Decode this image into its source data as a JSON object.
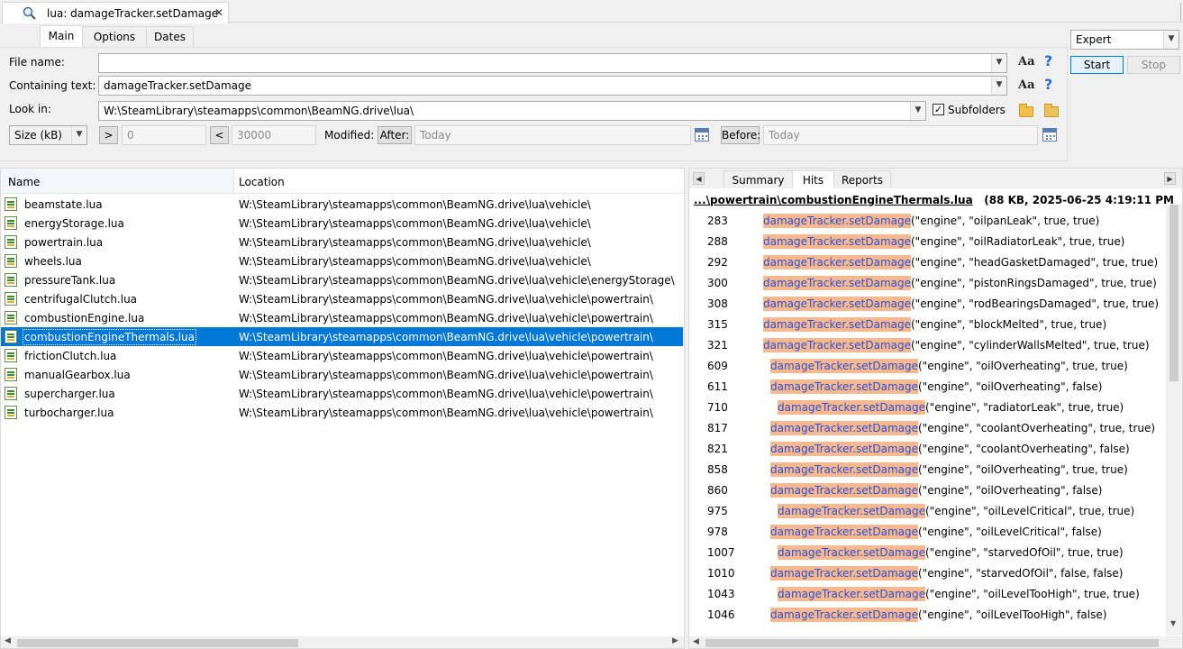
{
  "tab": {
    "title": "lua: damageTracker.setDamage"
  },
  "search": {
    "tabs": [
      "Main",
      "Options",
      "Dates"
    ],
    "file_name_label": "File name:",
    "file_name_value": "",
    "containing_text_label": "Containing text:",
    "containing_text_value": "damageTracker.setDamage",
    "look_in_label": "Look in:",
    "look_in_value": "W:\\SteamLibrary\\steamapps\\common\\BeamNG.drive\\lua\\",
    "subfolders_label": "Subfolders",
    "subfolders_checked": true,
    "size_unit": "Size (kB)",
    "gt_label": ">",
    "gt_value": "0",
    "lt_label": "<",
    "lt_value": "30000",
    "modified_label": "Modified:",
    "after_label": "After:",
    "after_value": "Today",
    "before_label": "Before:",
    "before_value": "Today",
    "mode": "Expert",
    "start_label": "Start",
    "stop_label": "Stop",
    "aa_label": "Aa",
    "help_label": "?"
  },
  "results": {
    "columns": [
      "Name",
      "Location"
    ],
    "rows": [
      {
        "name": "beamstate.lua",
        "location": "W:\\SteamLibrary\\steamapps\\common\\BeamNG.drive\\lua\\vehicle\\"
      },
      {
        "name": "energyStorage.lua",
        "location": "W:\\SteamLibrary\\steamapps\\common\\BeamNG.drive\\lua\\vehicle\\"
      },
      {
        "name": "powertrain.lua",
        "location": "W:\\SteamLibrary\\steamapps\\common\\BeamNG.drive\\lua\\vehicle\\"
      },
      {
        "name": "wheels.lua",
        "location": "W:\\SteamLibrary\\steamapps\\common\\BeamNG.drive\\lua\\vehicle\\"
      },
      {
        "name": "pressureTank.lua",
        "location": "W:\\SteamLibrary\\steamapps\\common\\BeamNG.drive\\lua\\vehicle\\energyStorage\\"
      },
      {
        "name": "centrifugalClutch.lua",
        "location": "W:\\SteamLibrary\\steamapps\\common\\BeamNG.drive\\lua\\vehicle\\powertrain\\"
      },
      {
        "name": "combustionEngine.lua",
        "location": "W:\\SteamLibrary\\steamapps\\common\\BeamNG.drive\\lua\\vehicle\\powertrain\\"
      },
      {
        "name": "combustionEngineThermals.lua",
        "location": "W:\\SteamLibrary\\steamapps\\common\\BeamNG.drive\\lua\\vehicle\\powertrain\\",
        "selected": true
      },
      {
        "name": "frictionClutch.lua",
        "location": "W:\\SteamLibrary\\steamapps\\common\\BeamNG.drive\\lua\\vehicle\\powertrain\\"
      },
      {
        "name": "manualGearbox.lua",
        "location": "W:\\SteamLibrary\\steamapps\\common\\BeamNG.drive\\lua\\vehicle\\powertrain\\"
      },
      {
        "name": "supercharger.lua",
        "location": "W:\\SteamLibrary\\steamapps\\common\\BeamNG.drive\\lua\\vehicle\\powertrain\\"
      },
      {
        "name": "turbocharger.lua",
        "location": "W:\\SteamLibrary\\steamapps\\common\\BeamNG.drive\\lua\\vehicle\\powertrain\\"
      }
    ]
  },
  "preview": {
    "tabs": [
      "Summary",
      "Hits",
      "Reports"
    ],
    "active_tab": "Hits",
    "file_path": "...\\powertrain\\combustionEngineThermals.lua",
    "file_info": "(88 KB,  2025-06-25 4:19:11 PM",
    "match_text": "damageTracker.setDamage",
    "hits": [
      {
        "line": "283",
        "indent": 0,
        "rest": "(\"engine\", \"oilpanLeak\", true, true)"
      },
      {
        "line": "288",
        "indent": 0,
        "rest": "(\"engine\", \"oilRadiatorLeak\", true, true)"
      },
      {
        "line": "292",
        "indent": 0,
        "rest": "(\"engine\", \"headGasketDamaged\", true, true)"
      },
      {
        "line": "300",
        "indent": 0,
        "rest": "(\"engine\", \"pistonRingsDamaged\", true, true)"
      },
      {
        "line": "308",
        "indent": 0,
        "rest": "(\"engine\", \"rodBearingsDamaged\", true, true)"
      },
      {
        "line": "315",
        "indent": 0,
        "rest": "(\"engine\", \"blockMelted\", true, true)"
      },
      {
        "line": "321",
        "indent": 0,
        "rest": "(\"engine\", \"cylinderWallsMelted\", true, true)"
      },
      {
        "line": "609",
        "indent": 1,
        "rest": "(\"engine\", \"oilOverheating\", true, true)"
      },
      {
        "line": "611",
        "indent": 1,
        "rest": "(\"engine\", \"oilOverheating\", false)"
      },
      {
        "line": "710",
        "indent": 2,
        "rest": "(\"engine\", \"radiatorLeak\", true, true)"
      },
      {
        "line": "817",
        "indent": 1,
        "rest": "(\"engine\", \"coolantOverheating\", true, true)"
      },
      {
        "line": "821",
        "indent": 1,
        "rest": "(\"engine\", \"coolantOverheating\", false)"
      },
      {
        "line": "858",
        "indent": 1,
        "rest": "(\"engine\", \"oilOverheating\", true, true)"
      },
      {
        "line": "860",
        "indent": 1,
        "rest": "(\"engine\", \"oilOverheating\", false)"
      },
      {
        "line": "975",
        "indent": 2,
        "rest": "(\"engine\", \"oilLevelCritical\", true, true)"
      },
      {
        "line": "978",
        "indent": 1,
        "rest": "(\"engine\", \"oilLevelCritical\", false)"
      },
      {
        "line": "1007",
        "indent": 2,
        "rest": "(\"engine\", \"starvedOfOil\", true, true)"
      },
      {
        "line": "1010",
        "indent": 1,
        "rest": "(\"engine\", \"starvedOfOil\", false, false)"
      },
      {
        "line": "1043",
        "indent": 2,
        "rest": "(\"engine\", \"oilLevelTooHigh\", true, true)"
      },
      {
        "line": "1046",
        "indent": 1,
        "rest": "(\"engine\", \"oilLevelTooHigh\", false)"
      }
    ]
  },
  "colors": {
    "accent": "#0078d7",
    "match_bg": "#f9b98e",
    "match_fg": "#2b4fd8",
    "help": "#2a6ad3"
  }
}
